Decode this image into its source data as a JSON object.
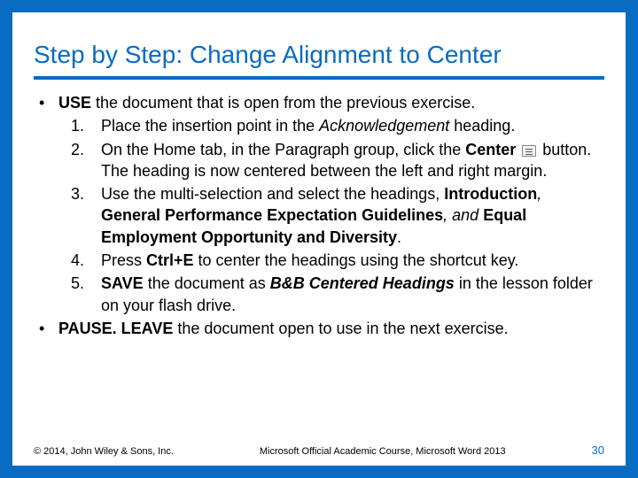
{
  "title": "Step by Step: Change Alignment to Center",
  "intro_prefix": "USE",
  "intro_rest": " the document that is open from the previous exercise.",
  "steps": {
    "s1": "Place the insertion point in the ",
    "s1_em": "Acknowledgement",
    "s1_end": " heading.",
    "s2a": "On the Home tab, in the Paragraph group, click the ",
    "s2_bold": "Center",
    "s2b": " button. The heading is now centered between the left and right margin.",
    "s3a": "Use the multi-selection and select the headings, ",
    "s3_h1": "Introduction",
    "s3_c1": ", ",
    "s3_h2": "General Performance Expectation Guidelines",
    "s3_c2": ", and ",
    "s3_h3": "Equal Employment Opportunity and Diversity",
    "s3_end": ".",
    "s4a": "Press ",
    "s4_key": "Ctrl+E",
    "s4b": " to center the headings using the shortcut key.",
    "s5_cmd": "SAVE",
    "s5a": " the document as ",
    "s5_name": "B&B Centered Headings",
    "s5b": " in the lesson folder on your flash drive."
  },
  "outro_cmd1": "PAUSE. LEAVE",
  "outro_rest": " the document open to use in the next exercise.",
  "footer": {
    "left": "© 2014, John Wiley & Sons, Inc.",
    "center": "Microsoft Official Academic Course, Microsoft Word 2013",
    "page": "30"
  },
  "num": {
    "n1": "1.",
    "n2": "2.",
    "n3": "3.",
    "n4": "4.",
    "n5": "5."
  },
  "bullet": "•"
}
